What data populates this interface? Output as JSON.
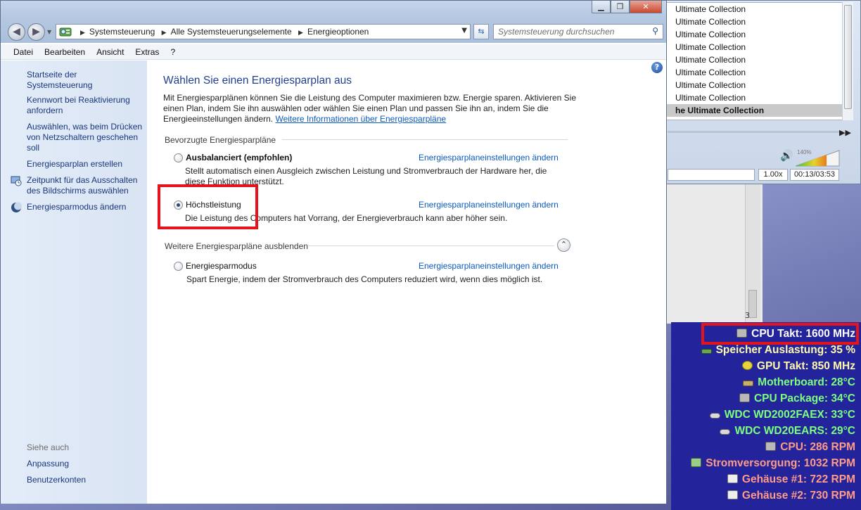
{
  "player": {
    "playlist": [
      "Ultimate Collection",
      "Ultimate Collection",
      "Ultimate Collection",
      "Ultimate Collection",
      "Ultimate Collection",
      "Ultimate Collection",
      "Ultimate Collection",
      "Ultimate Collection",
      "he Ultimate Collection"
    ],
    "volume_percent": "140%",
    "speed": "1.00x",
    "time": "00:13/03:53"
  },
  "underlying": {
    "mark": "3"
  },
  "window": {
    "caption": {
      "minimize": "▁",
      "maximize": "❐",
      "close": "✕"
    },
    "breadcrumb": [
      "Systemsteuerung",
      "Alle Systemsteuerungselemente",
      "Energieoptionen"
    ],
    "search_placeholder": "Systemsteuerung durchsuchen",
    "menu": [
      "Datei",
      "Bearbeiten",
      "Ansicht",
      "Extras",
      "?"
    ]
  },
  "sidebar": {
    "home": "Startseite der Systemsteuerung",
    "links": [
      "Kennwort bei Reaktivierung anfordern",
      "Auswählen, was beim Drücken von Netzschaltern geschehen soll",
      "Energiesparplan erstellen",
      "Zeitpunkt für das Ausschalten des Bildschirms auswählen",
      "Energiesparmodus ändern"
    ],
    "see_also": {
      "heading": "Siehe auch",
      "links": [
        "Anpassung",
        "Benutzerkonten"
      ]
    }
  },
  "content": {
    "title": "Wählen Sie einen Energiesparplan aus",
    "intro": "Mit Energiesparplänen können Sie die Leistung des Computer maximieren bzw. Energie sparen. Aktivieren Sie einen Plan, indem Sie ihn auswählen oder wählen Sie einen Plan und passen Sie ihn an, indem Sie die Energieeinstellungen ändern.",
    "more_info_link": "Weitere Informationen über Energiesparpläne",
    "preferred_heading": "Bevorzugte Energiesparpläne",
    "more_heading": "Weitere Energiesparpläne ausblenden",
    "plans": [
      {
        "name": "Ausbalanciert (empfohlen)",
        "description": "Stellt automatisch einen Ausgleich zwischen Leistung und Stromverbrauch der Hardware her, die diese Funktion unterstützt.",
        "link": "Energiesparplaneinstellungen ändern",
        "selected": false
      },
      {
        "name": "Höchstleistung",
        "description": "Die Leistung des Computers hat Vorrang, der Energieverbrauch kann aber höher sein.",
        "link": "Energiesparplaneinstellungen ändern",
        "selected": true
      },
      {
        "name": "Energiesparmodus",
        "description": "Spart Energie, indem der Stromverbrauch des Computers reduziert wird, wenn dies möglich ist.",
        "link": "Energiesparplaneinstellungen ändern",
        "selected": false
      }
    ]
  },
  "sensors": [
    {
      "text": "CPU Takt: 1600 MHz",
      "color": "#ffffff",
      "icon": "cpu-chip-icon"
    },
    {
      "text": "Speicher Auslastung: 35 %",
      "color": "#fff8a8",
      "icon": "memory-icon"
    },
    {
      "text": "GPU Takt: 850 MHz",
      "color": "#fff8a8",
      "icon": "gpu-icon"
    },
    {
      "text": "Motherboard: 28°C",
      "color": "#7dff7d",
      "icon": "motherboard-icon"
    },
    {
      "text": "CPU Package: 34°C",
      "color": "#7dff7d",
      "icon": "cpu-chip-icon"
    },
    {
      "text": "WDC WD2002FAEX: 33°C",
      "color": "#7dff7d",
      "icon": "hard-drive-icon"
    },
    {
      "text": "WDC WD20EARS: 29°C",
      "color": "#7dff7d",
      "icon": "hard-drive-icon"
    },
    {
      "text": "CPU: 286 RPM",
      "color": "#ff9b86",
      "icon": "cpu-chip-icon"
    },
    {
      "text": "Stromversorgung: 1032 RPM",
      "color": "#ff9b86",
      "icon": "power-supply-icon"
    },
    {
      "text": "Gehäuse #1: 722 RPM",
      "color": "#ff9b86",
      "icon": "case-icon"
    },
    {
      "text": "Gehäuse #2: 730 RPM",
      "color": "#ff9b86",
      "icon": "case-icon"
    }
  ],
  "colors": {
    "highlight": "#e5141b",
    "sensor_background": "#23239c",
    "link": "#0b5bc0",
    "title": "#1f3f8f"
  }
}
